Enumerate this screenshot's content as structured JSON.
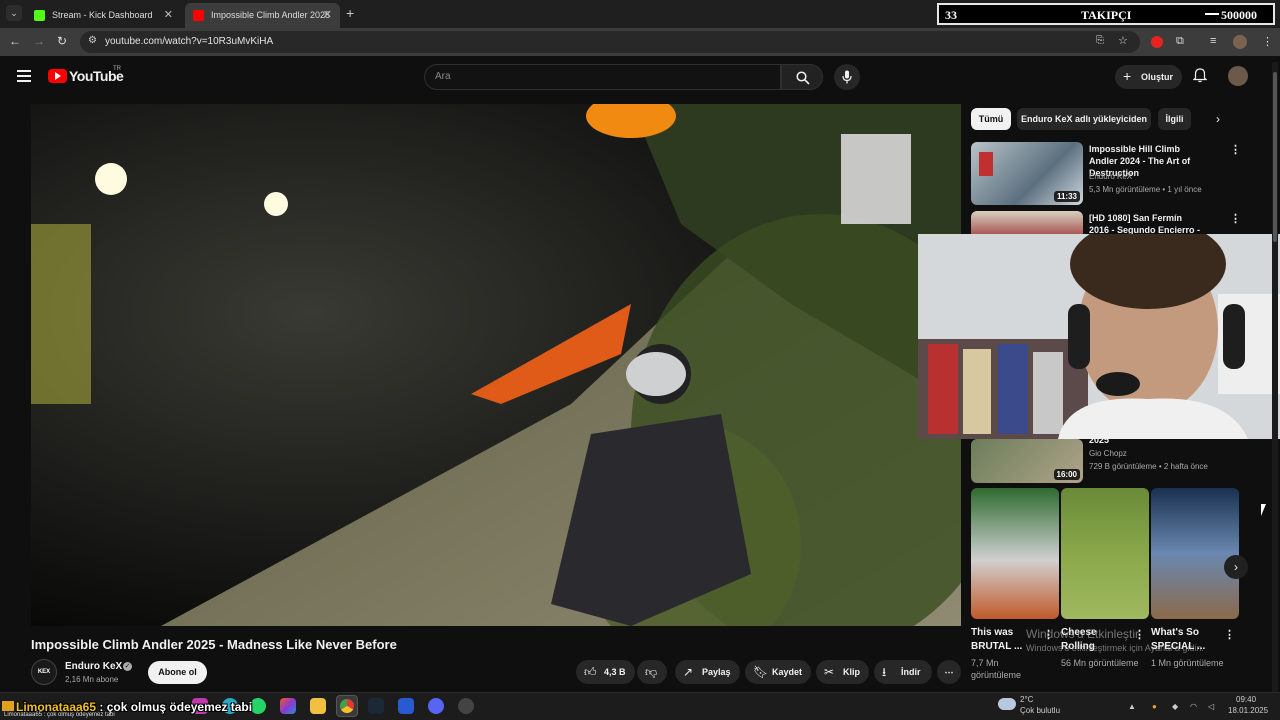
{
  "browser": {
    "tabs": [
      {
        "title": "Stream - Kick Dashboard",
        "favicon_color": "#53fc18",
        "active": false
      },
      {
        "title": "Impossible Climb Andler 2025",
        "favicon_color": "#ff0000",
        "active": true
      }
    ],
    "url": "youtube.com/watch?v=10R3uMvKiHA",
    "new_tab_symbol": "+",
    "close_symbol": "✕"
  },
  "follower_overlay": {
    "count": "33",
    "label": "TAKIPÇI",
    "goal": "500000"
  },
  "youtube": {
    "logo_text": "YouTube",
    "country_code": "TR",
    "search_placeholder": "Ara",
    "create_label": "Oluştur"
  },
  "video": {
    "title": "Impossible Climb Andler 2025 - Madness Like Never Before",
    "channel": "Enduro KeX",
    "channel_avatar_text": "KEX",
    "subscribers": "2,16 Mn abone",
    "subscribe_label": "Abone ol",
    "like_count": "4,3 B",
    "share_label": "Paylaş",
    "save_label": "Kaydet",
    "clip_label": "Klip",
    "download_label": "İndir"
  },
  "filter_chips": [
    "Tümü",
    "Enduro KeX adlı yükleyiciden",
    "İlgili"
  ],
  "recommendations": [
    {
      "title": "Impossible Hill Climb Andler 2024 - The Art of Destruction",
      "channel": "Enduro KeX",
      "meta": "5,3 Mn görüntüleme • 1 yıl önce",
      "duration": "11:33"
    },
    {
      "title": "[HD 1080] San Fermín 2016 - Segundo Encierro - Toros de la...",
      "channel": "",
      "meta": "",
      "duration": ""
    },
    {
      "title": "2025",
      "channel": "Gio Chopz",
      "meta": "729 B görüntüleme • 2 hafta önce",
      "duration": "16:00"
    }
  ],
  "shorts": [
    {
      "title": "This was BRUTAL ...",
      "views": "7,7 Mn görüntüleme"
    },
    {
      "title": "Cheese Rolling",
      "views": "56 Mn görüntüleme"
    },
    {
      "title": "What's So SPECIAL ...",
      "views": "1 Mn görüntüleme"
    }
  ],
  "watermark": {
    "line1": "Windows'u Etkinleştir",
    "line2": "Windows'u etkinleştirmek için Ayarlar'a gidin."
  },
  "chat_overlay": {
    "username": "Limonataaa65",
    "message": "çok olmuş ödeyemez tabi",
    "small": "Limonataaa65 : çok olmuş ödeyemez tabi"
  },
  "taskbar": {
    "weather_temp": "2°C",
    "weather_desc": "Çok bulutlu",
    "time": "09:40",
    "date": "18.01.2025"
  },
  "icons": {
    "back": "back-arrow-icon",
    "forward": "forward-arrow-icon",
    "reload": "reload-icon",
    "search": "search-icon",
    "mic": "microphone-icon",
    "bell": "bell-icon",
    "like": "thumbs-up-icon",
    "dislike": "thumbs-down-icon",
    "share": "share-icon",
    "save": "bookmark-icon",
    "clip": "scissors-icon",
    "download": "download-icon"
  },
  "colors": {
    "youtube_red": "#ff0000",
    "background": "#0f0f0f",
    "kick_green": "#53fc18"
  }
}
